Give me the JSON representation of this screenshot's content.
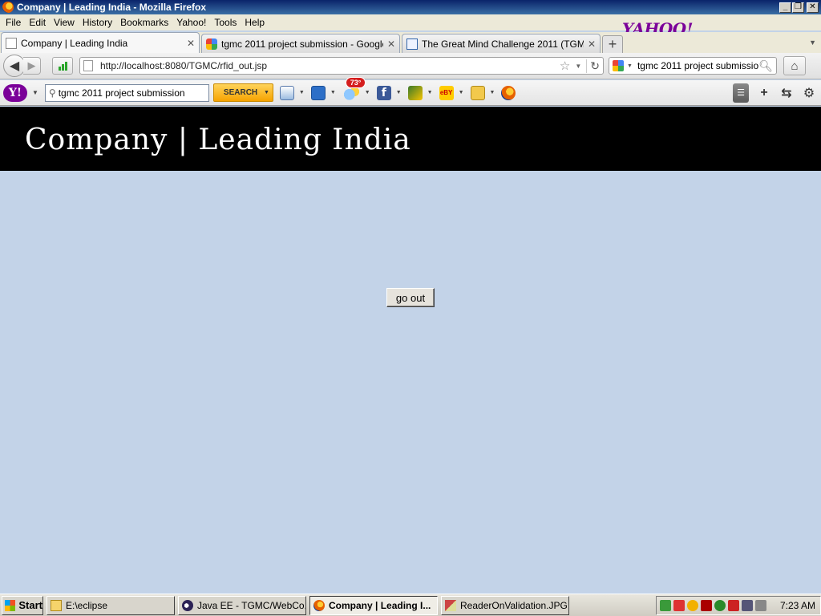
{
  "window": {
    "title": "Company | Leading India - Mozilla Firefox"
  },
  "menu": [
    "File",
    "Edit",
    "View",
    "History",
    "Bookmarks",
    "Yahoo!",
    "Tools",
    "Help"
  ],
  "brand_logo": "YAHOO!",
  "tabs": [
    {
      "label": "Company | Leading India",
      "active": true
    },
    {
      "label": "tgmc 2011 project submission - Google S...",
      "active": false
    },
    {
      "label": "The Great Mind Challenge 2011 (TGMC 2...",
      "active": false
    }
  ],
  "nav": {
    "url": "http://localhost:8080/TGMC/rfid_out.jsp",
    "search_value": "tgmc 2011 project submission"
  },
  "yahoo_toolbar": {
    "search_value": "tgmc 2011 project submission",
    "search_button": "SEARCH",
    "weather_badge": "73°"
  },
  "page": {
    "site_title": "Company | Leading India",
    "go_out_button": "go out",
    "background_color": "#c3d3e8",
    "header_color": "#000000"
  },
  "taskbar": {
    "start_label": "Start",
    "tasks": [
      {
        "label": "E:\\eclipse",
        "icon": "folder-icon",
        "active": false
      },
      {
        "label": "Java EE - TGMC/WebCo...",
        "icon": "eclipse-icon",
        "active": false
      },
      {
        "label": "Company | Leading I...",
        "icon": "firefox-icon",
        "active": true
      },
      {
        "label": "ReaderOnValidation.JPG ...",
        "icon": "image-icon",
        "active": false
      }
    ],
    "clock": "7:23 AM"
  }
}
